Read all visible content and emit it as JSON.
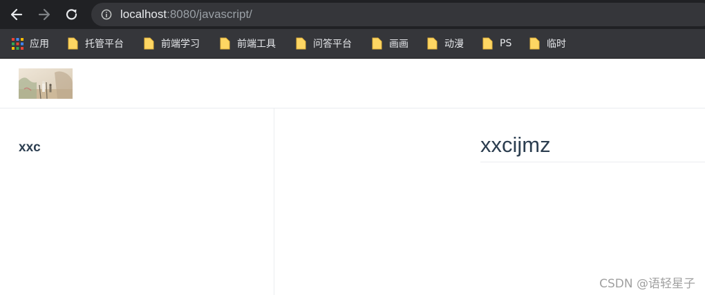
{
  "browser": {
    "url_host": "localhost",
    "url_rest": ":8080/javascript/",
    "icons": {
      "back": "arrow-left-icon",
      "forward": "arrow-right-icon",
      "reload": "reload-icon",
      "site_info": "info-icon"
    },
    "bookmarks": [
      {
        "label": "应用",
        "icon": "apps-grid-icon"
      },
      {
        "label": "托管平台",
        "icon": "folder-icon"
      },
      {
        "label": "前端学习",
        "icon": "folder-icon"
      },
      {
        "label": "前端工具",
        "icon": "folder-icon"
      },
      {
        "label": "问答平台",
        "icon": "folder-icon"
      },
      {
        "label": "画画",
        "icon": "folder-icon"
      },
      {
        "label": "动漫",
        "icon": "folder-icon"
      },
      {
        "label": "PS",
        "icon": "folder-icon"
      },
      {
        "label": "临时",
        "icon": "folder-icon"
      }
    ]
  },
  "site": {
    "logo": "site-logo-image",
    "sidebar_title": "xxc",
    "page_title": "xxcijmz"
  },
  "watermark": "CSDN @语轻星子"
}
